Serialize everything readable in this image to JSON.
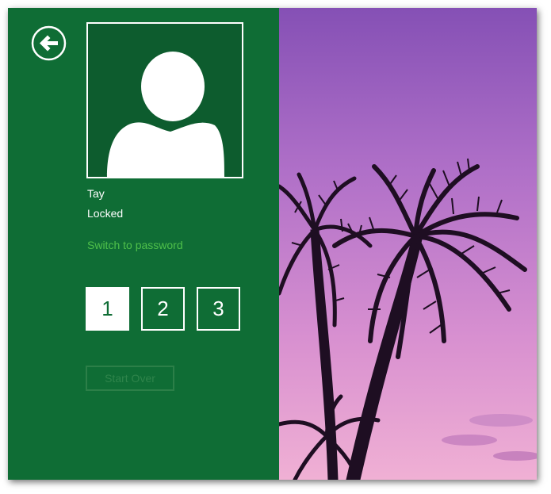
{
  "user": {
    "name": "Tay",
    "status": "Locked"
  },
  "actions": {
    "switch_link": "Switch to password",
    "start_over": "Start Over"
  },
  "pins": [
    {
      "label": "1",
      "selected": true
    },
    {
      "label": "2",
      "selected": false
    },
    {
      "label": "3",
      "selected": false
    }
  ],
  "icons": {
    "back": "back-arrow-icon",
    "avatar": "user-silhouette-icon"
  },
  "colors": {
    "panel": "#0f6d35",
    "avatar_bg": "#0d5c2e",
    "link": "#4fc04a",
    "sky_top": "#8a56b8",
    "sky_bottom": "#e7a2cf"
  }
}
